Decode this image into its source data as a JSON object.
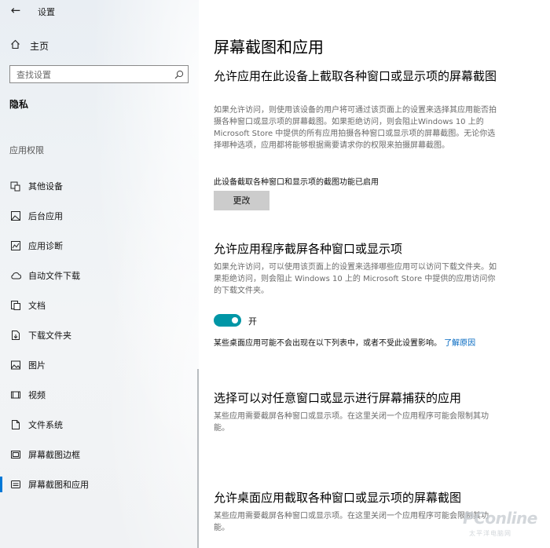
{
  "window": {
    "title": "设置",
    "back_icon": "back-arrow-icon"
  },
  "sidebar": {
    "home_label": "主页",
    "search_placeholder": "查找设置",
    "section_title": "隐私",
    "group_title": "应用权限",
    "items": [
      {
        "label": "其他设备",
        "icon": "other-devices-icon"
      },
      {
        "label": "后台应用",
        "icon": "background-apps-icon"
      },
      {
        "label": "应用诊断",
        "icon": "app-diagnostics-icon"
      },
      {
        "label": "自动文件下载",
        "icon": "cloud-icon"
      },
      {
        "label": "文档",
        "icon": "documents-icon"
      },
      {
        "label": "下载文件夹",
        "icon": "download-folder-icon"
      },
      {
        "label": "图片",
        "icon": "pictures-icon"
      },
      {
        "label": "视频",
        "icon": "videos-icon"
      },
      {
        "label": "文件系统",
        "icon": "file-system-icon"
      },
      {
        "label": "屏幕截图边框",
        "icon": "screenshot-border-icon"
      },
      {
        "label": "屏幕截图和应用",
        "icon": "screenshot-apps-icon",
        "active": true
      }
    ],
    "accent_color": "#0078d7"
  },
  "main": {
    "title": "屏幕截图和应用",
    "section1": {
      "heading": "允许应用在此设备上截取各种窗口或显示项的屏幕截图",
      "description": "如果允许访问，则使用该设备的用户将可通过该页面上的设置来选择其应用能否拍摄各种窗口或显示项的屏幕截图。如果拒绝访问，则会阻止Windows 10 上的 Microsoft Store 中提供的所有应用拍摄各种窗口或显示项的屏幕截图。无论你选择哪种选项，应用都将能够根据需要请求你的权限来拍摄屏幕截图。",
      "status": "此设备截取各种窗口和显示项的截图功能已启用",
      "button_label": "更改"
    },
    "section2": {
      "heading": "允许应用程序截屏各种窗口或显示项",
      "description": "如果允许访问，可以使用该页面上的设置来选择哪些应用可以访问下载文件夹。如果拒绝访问，则会阻止 Windows 10 上的 Microsoft Store 中提供的应用访问你的下载文件夹。",
      "toggle_state": "开",
      "toggle_on": true,
      "toggle_color": "#0096a6",
      "note": "某些桌面应用可能不会出现在以下列表中，或者不受此设置影响。",
      "link": "了解原因"
    },
    "section3": {
      "heading": "选择可以对任意窗口或显示进行屏幕捕获的应用",
      "description": "某些应用需要截屏各种窗口或显示项。在这里关闭一个应用程序可能会限制其功能。"
    },
    "section4": {
      "heading": "允许桌面应用截取各种窗口或显示项的屏幕截图",
      "description": "某些应用需要截屏各种窗口或显示项。在这里关闭一个应用程序可能会限制其功能。"
    },
    "watermark": "PConline",
    "watermark_sub": "太平洋电脑网"
  }
}
